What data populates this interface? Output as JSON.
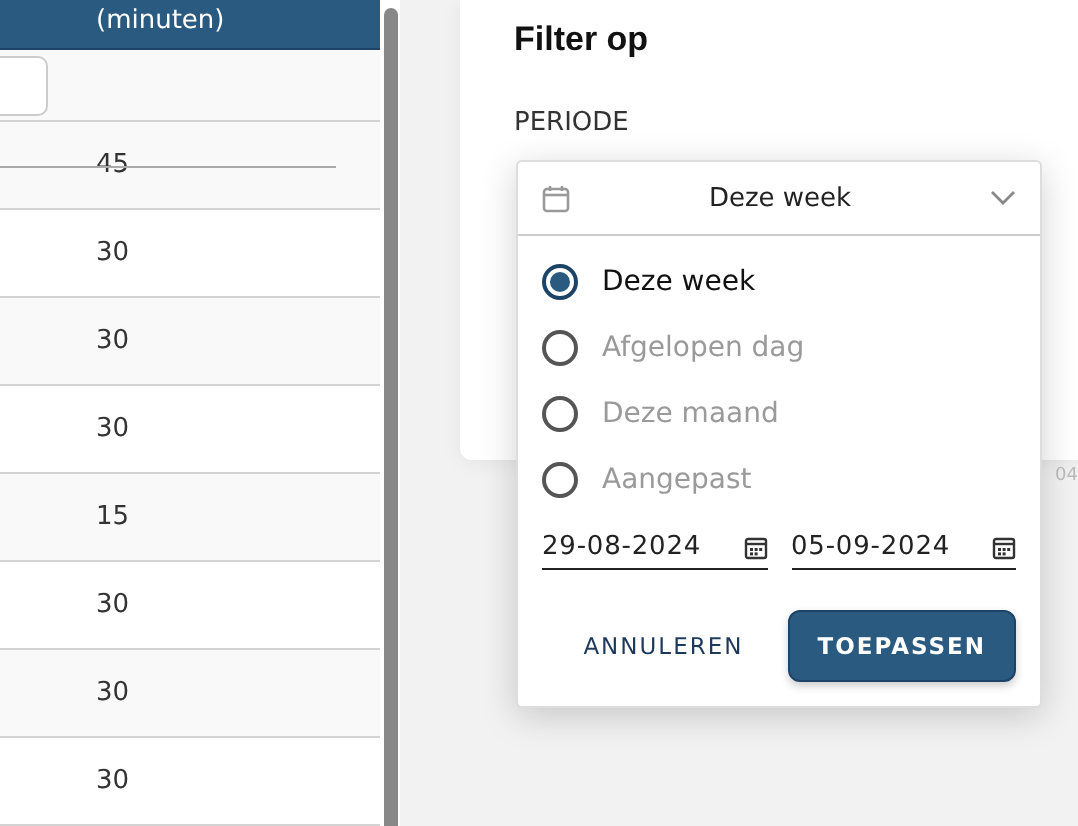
{
  "table": {
    "column_header": "(minuten)",
    "rows": [
      {
        "value": "45",
        "struck": true
      },
      {
        "value": "30",
        "struck": false
      },
      {
        "value": "30",
        "struck": false
      },
      {
        "value": "30",
        "struck": false
      },
      {
        "value": "15",
        "struck": false
      },
      {
        "value": "30",
        "struck": false
      },
      {
        "value": "30",
        "struck": false
      },
      {
        "value": "30",
        "struck": false
      }
    ]
  },
  "background_text": "04",
  "filter": {
    "title": "Filter op",
    "period_label": "PERIODE",
    "dropdown": {
      "value": "Deze week",
      "expanded": true,
      "options": [
        {
          "label": "Deze week",
          "selected": true
        },
        {
          "label": "Afgelopen dag",
          "selected": false
        },
        {
          "label": "Deze maand",
          "selected": false
        },
        {
          "label": "Aangepast",
          "selected": false
        }
      ],
      "start_date": "29-08-2024",
      "end_date": "05-09-2024",
      "buttons": [
        {
          "label": "ANNULEREN",
          "kind": "text"
        },
        {
          "label": "TOEPASSEN",
          "kind": "primary"
        }
      ]
    }
  }
}
